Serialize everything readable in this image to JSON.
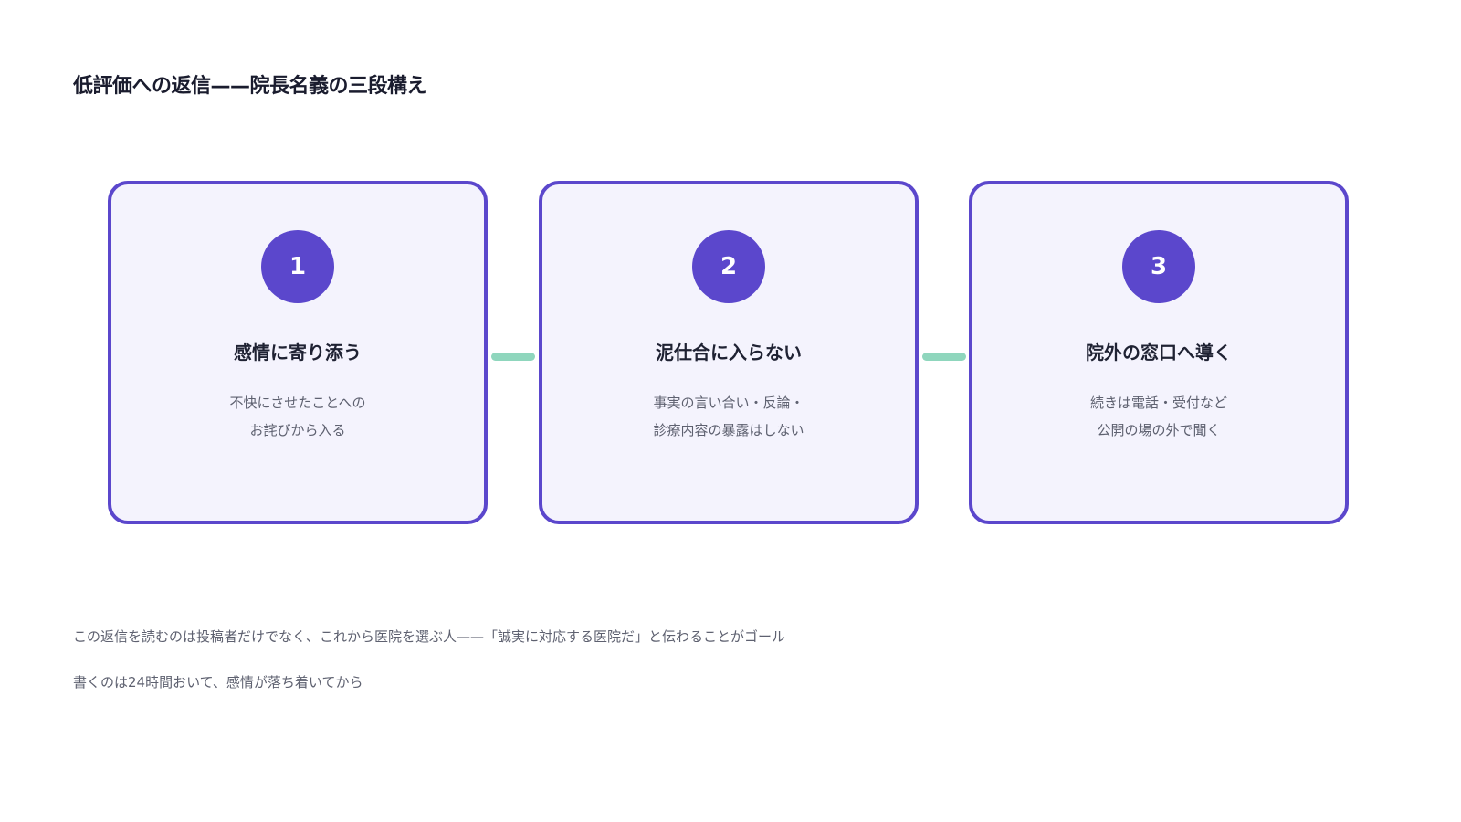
{
  "title": "低評価への返信——院長名義の三段構え",
  "steps": [
    {
      "number": "1",
      "title": "感情に寄り添う",
      "description": [
        "不快にさせたことへの",
        "お詫びから入る"
      ]
    },
    {
      "number": "2",
      "title": "泥仕合に入らない",
      "description": [
        "事実の言い合い・反論・",
        "診療内容の暴露はしない"
      ]
    },
    {
      "number": "3",
      "title": "院外の窓口へ導く",
      "description": [
        "続きは電話・受付など",
        "公開の場の外で聞く"
      ]
    }
  ],
  "notes": [
    "この返信を読むのは投稿者だけでなく、これから医院を選ぶ人——「誠実に対応する医院だ」と伝わることがゴール",
    "書くのは24時間おいて、感情が落ち着いてから"
  ],
  "colors": {
    "accent": "#5b47cc",
    "card_background": "#f4f3fd",
    "connector": "#8fd6bd",
    "heading_text": "#1f2233",
    "body_text": "#5e6170"
  }
}
